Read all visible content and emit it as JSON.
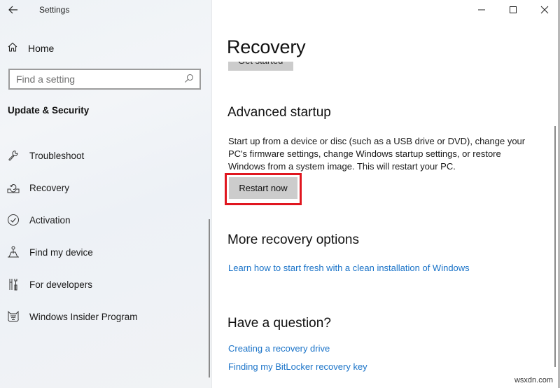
{
  "window": {
    "title": "Settings",
    "controls": {
      "minimize": "minimize",
      "maximize": "maximize",
      "close": "close"
    }
  },
  "sidebar": {
    "home_label": "Home",
    "search": {
      "placeholder": "Find a setting",
      "value": ""
    },
    "section_title": "Update & Security",
    "items": [
      {
        "label": "Troubleshoot",
        "icon": "wrench-icon"
      },
      {
        "label": "Recovery",
        "icon": "recovery-icon"
      },
      {
        "label": "Activation",
        "icon": "check-circle-icon"
      },
      {
        "label": "Find my device",
        "icon": "find-device-icon"
      },
      {
        "label": "For developers",
        "icon": "developer-tools-icon"
      },
      {
        "label": "Windows Insider Program",
        "icon": "insider-cat-icon"
      }
    ]
  },
  "main": {
    "page_title": "Recovery",
    "get_started_label": "Get started",
    "advanced_startup": {
      "heading": "Advanced startup",
      "description": "Start up from a device or disc (such as a USB drive or DVD), change your PC's firmware settings, change Windows startup settings, or restore Windows from a system image. This will restart your PC.",
      "button_label": "Restart now",
      "highlight_color": "#e0161f"
    },
    "more_options": {
      "heading": "More recovery options",
      "link": "Learn how to start fresh with a clean installation of Windows"
    },
    "question": {
      "heading": "Have a question?",
      "links": [
        "Creating a recovery drive",
        "Finding my BitLocker recovery key"
      ]
    }
  },
  "watermark": "wsxdn.com",
  "colors": {
    "link": "#1a73c8",
    "button": "#cccccc",
    "highlight": "#e0161f"
  }
}
